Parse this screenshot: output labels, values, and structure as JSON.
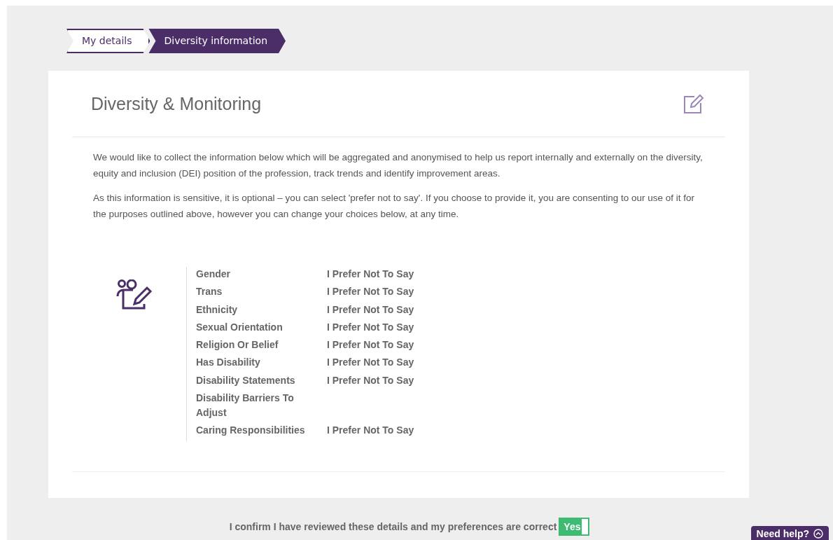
{
  "breadcrumb": [
    {
      "label": "My details",
      "selected": false
    },
    {
      "label": "Diversity information",
      "selected": true
    }
  ],
  "card": {
    "title": "Diversity & Monitoring",
    "paragraphs": [
      "We would like to collect the information below which will be aggregated and anonymised to help us report internally and externally on the diversity, equity and inclusion (DEI) position of the profession, track trends and identify improvement areas.",
      "As this information is sensitive, it is optional – you can select 'prefer not to say'. If you choose to provide it, you are consenting to our use of it for the purposes outlined above, however you can change your choices below, at any time."
    ],
    "rows": [
      {
        "label": "Gender",
        "value": "I Prefer Not To Say"
      },
      {
        "label": "Trans",
        "value": "I Prefer Not To Say"
      },
      {
        "label": "Ethnicity",
        "value": "I Prefer Not To Say"
      },
      {
        "label": "Sexual Orientation",
        "value": "I Prefer Not To Say"
      },
      {
        "label": "Religion Or Belief",
        "value": "I Prefer Not To Say"
      },
      {
        "label": "Has Disability",
        "value": "I Prefer Not To Say"
      },
      {
        "label": "Disability Statements",
        "value": "I Prefer Not To Say"
      },
      {
        "label": "Disability Barriers To Adjust"
      },
      {
        "label": "Caring Responsibilities",
        "value": "I Prefer Not To Say"
      }
    ]
  },
  "confirm": {
    "label": "I confirm I have reviewed these details and my preferences are correct",
    "toggle": {
      "label": "Yes",
      "on": true
    }
  },
  "help_button": {
    "label": "Need help?"
  }
}
